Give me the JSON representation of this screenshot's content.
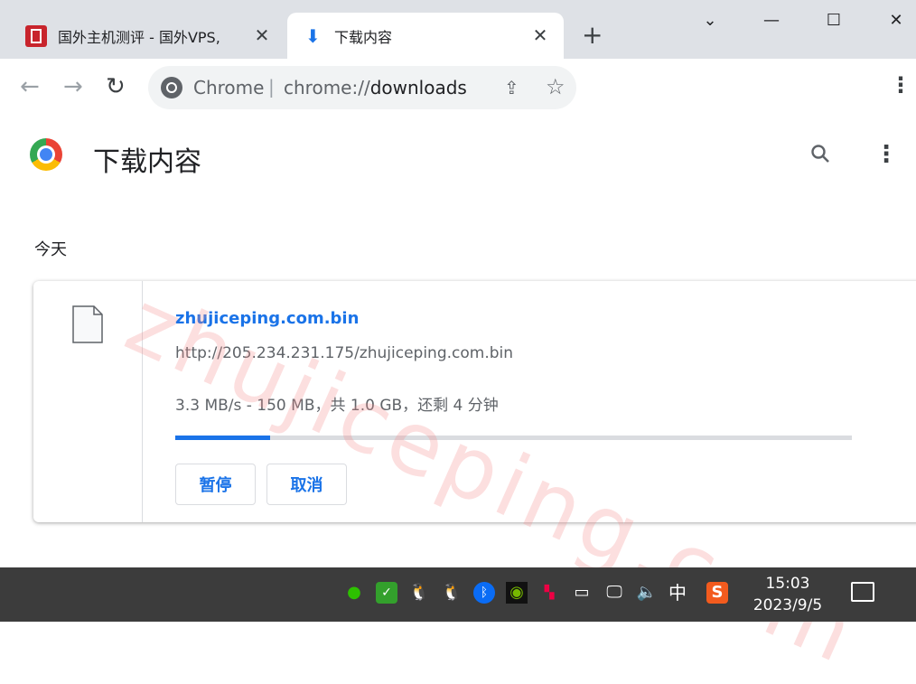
{
  "tabs": [
    {
      "title": "国外主机测评 - 国外VPS,",
      "close": "✕",
      "icon": "site-favicon-icon"
    },
    {
      "title": "下载内容",
      "close": "✕",
      "icon": "download-icon"
    }
  ],
  "new_tab": "+",
  "window_controls": {
    "dropdown": "⌄",
    "minimize": "—",
    "maximize": "☐",
    "close": "✕"
  },
  "omnibox": {
    "label": "Chrome",
    "separator": "|",
    "url_scheme": "chrome://",
    "url_host": "downloads"
  },
  "page": {
    "title": "下载内容",
    "section": "今天"
  },
  "download": {
    "filename": "zhujiceping.com.bin",
    "url": "http://205.234.231.175/zhujiceping.com.bin",
    "status": "3.3 MB/s - 150 MB，共 1.0 GB，还剩 4 分钟",
    "progress_fraction": 0.14,
    "pause_label": "暂停",
    "cancel_label": "取消"
  },
  "watermark": "zhujiceping.com",
  "taskbar": {
    "time": "15:03",
    "date": "2023/9/5",
    "ime": "中",
    "tray_icons": [
      "wechat-icon",
      "security-icon",
      "qq-icon",
      "qq-icon",
      "bluetooth-icon",
      "nvidia-icon",
      "app-icon",
      "battery-icon",
      "network-icon",
      "volume-icon",
      "ime-icon",
      "sogou-icon"
    ]
  },
  "colors": {
    "accent": "#1a73e8",
    "tab_strip": "#dee1e6",
    "taskbar": "#3c3c3c"
  }
}
